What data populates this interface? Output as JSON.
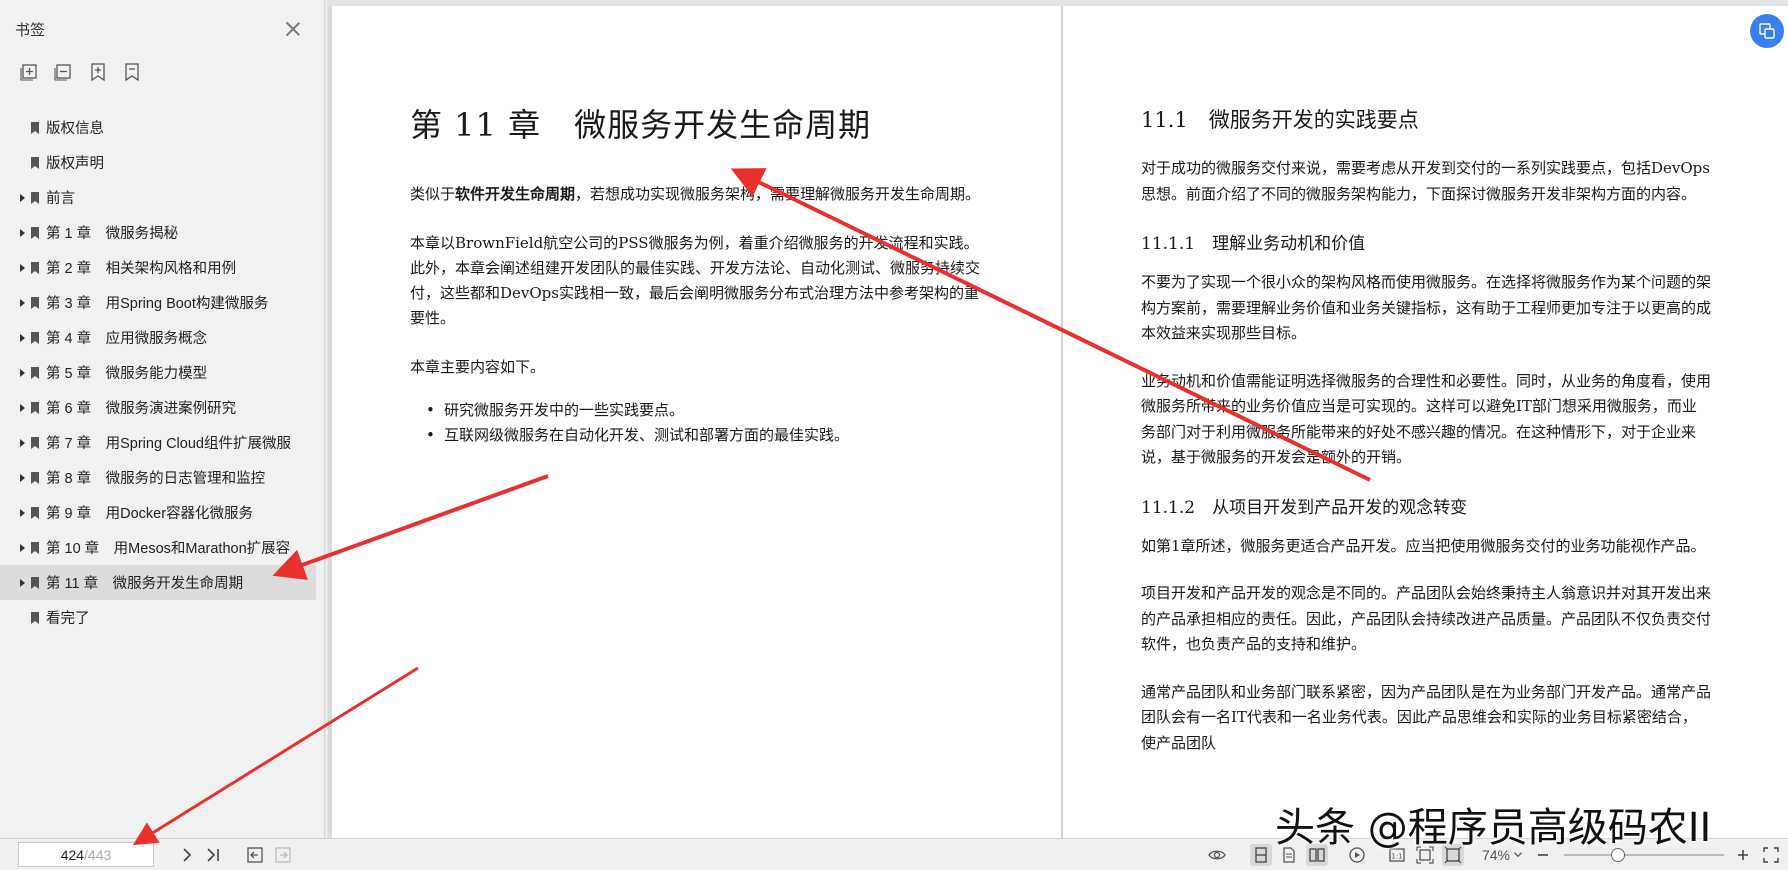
{
  "sidebar": {
    "title": "书签",
    "tools": [
      "add-bookmark-icon",
      "remove-bookmark-icon",
      "bookmark-add-icon",
      "bookmark-icon"
    ],
    "items": [
      {
        "label": "版权信息",
        "expandable": false,
        "active": false
      },
      {
        "label": "版权声明",
        "expandable": false,
        "active": false
      },
      {
        "label": "前言",
        "expandable": true,
        "active": false
      },
      {
        "label": "第 1 章　微服务揭秘",
        "expandable": true,
        "active": false
      },
      {
        "label": "第 2 章　相关架构风格和用例",
        "expandable": true,
        "active": false
      },
      {
        "label": "第 3 章　用Spring Boot构建微服务",
        "expandable": true,
        "active": false
      },
      {
        "label": "第 4 章　应用微服务概念",
        "expandable": true,
        "active": false
      },
      {
        "label": "第 5 章　微服务能力模型",
        "expandable": true,
        "active": false
      },
      {
        "label": "第 6 章　微服务演进案例研究",
        "expandable": true,
        "active": false
      },
      {
        "label": "第 7 章　用Spring Cloud组件扩展微服",
        "expandable": true,
        "active": false
      },
      {
        "label": "第 8 章　微服务的日志管理和监控",
        "expandable": true,
        "active": false
      },
      {
        "label": "第 9 章　用Docker容器化微服务",
        "expandable": true,
        "active": false
      },
      {
        "label": "第 10 章　用Mesos和Marathon扩展容",
        "expandable": true,
        "active": false
      },
      {
        "label": "第 11 章　微服务开发生命周期",
        "expandable": true,
        "active": true
      },
      {
        "label": "看完了",
        "expandable": false,
        "active": false
      }
    ]
  },
  "left_page": {
    "chapter_title": "第 11 章　微服务开发生命周期",
    "p1_prefix": "类似于",
    "p1_bold": "软件开发生命周期",
    "p1_rest": "，若想成功实现微服务架构，需要理解微服务开发生命周期。",
    "p2": "本章以BrownField航空公司的PSS微服务为例，着重介绍微服务的开发流程和实践。此外，本章会阐述组建开发团队的最佳实践、开发方法论、自动化测试、微服务持续交付，这些都和DevOps实践相一致，最后会阐明微服务分布式治理方法中参考架构的重要性。",
    "p3": "本章主要内容如下。",
    "bullets": [
      "研究微服务开发中的一些实践要点。",
      "互联网级微服务在自动化开发、测试和部署方面的最佳实践。"
    ]
  },
  "right_page": {
    "h2": "11.1　微服务开发的实践要点",
    "p1": "对于成功的微服务交付来说，需要考虑从开发到交付的一系列实践要点，包括DevOps思想。前面介绍了不同的微服务架构能力，下面探讨微服务开发非架构方面的内容。",
    "h3a": "11.1.1　理解业务动机和价值",
    "p2": "不要为了实现一个很小众的架构风格而使用微服务。在选择将微服务作为某个问题的架构方案前，需要理解业务价值和业务关键指标，这有助于工程师更加专注于以更高的成本效益来实现那些目标。",
    "p3": "业务动机和价值需能证明选择微服务的合理性和必要性。同时，从业务的角度看，使用微服务所带来的业务价值应当是可实现的。这样可以避免IT部门想采用微服务，而业务部门对于利用微服务所能带来的好处不感兴趣的情况。在这种情形下，对于企业来说，基于微服务的开发会是额外的开销。",
    "h3b": "11.1.2　从项目开发到产品开发的观念转变",
    "p4": "如第1章所述，微服务更适合产品开发。应当把使用微服务交付的业务功能视作产品。",
    "p5": "项目开发和产品开发的观念是不同的。产品团队会始终秉持主人翁意识并对其开发出来的产品承担相应的责任。因此，产品团队会持续改进产品质量。产品团队不仅负责交付软件，也负责产品的支持和维护。",
    "p6": "通常产品团队和业务部门联系紧密，因为产品团队是在为业务部门开发产品。通常产品团队会有一名IT代表和一名业务代表。因此产品思维会和实际的业务目标紧密结合，使产品团队"
  },
  "statusbar": {
    "current_page": "424",
    "total_pages": "/443",
    "zoom": "74%",
    "zoom_level_fraction": 0.32
  },
  "watermark": "头条 @程序员高级码农II",
  "colors": {
    "arrow": "#e8312f",
    "accent": "#3a7ff0",
    "active_bg": "#dcdcdc"
  }
}
